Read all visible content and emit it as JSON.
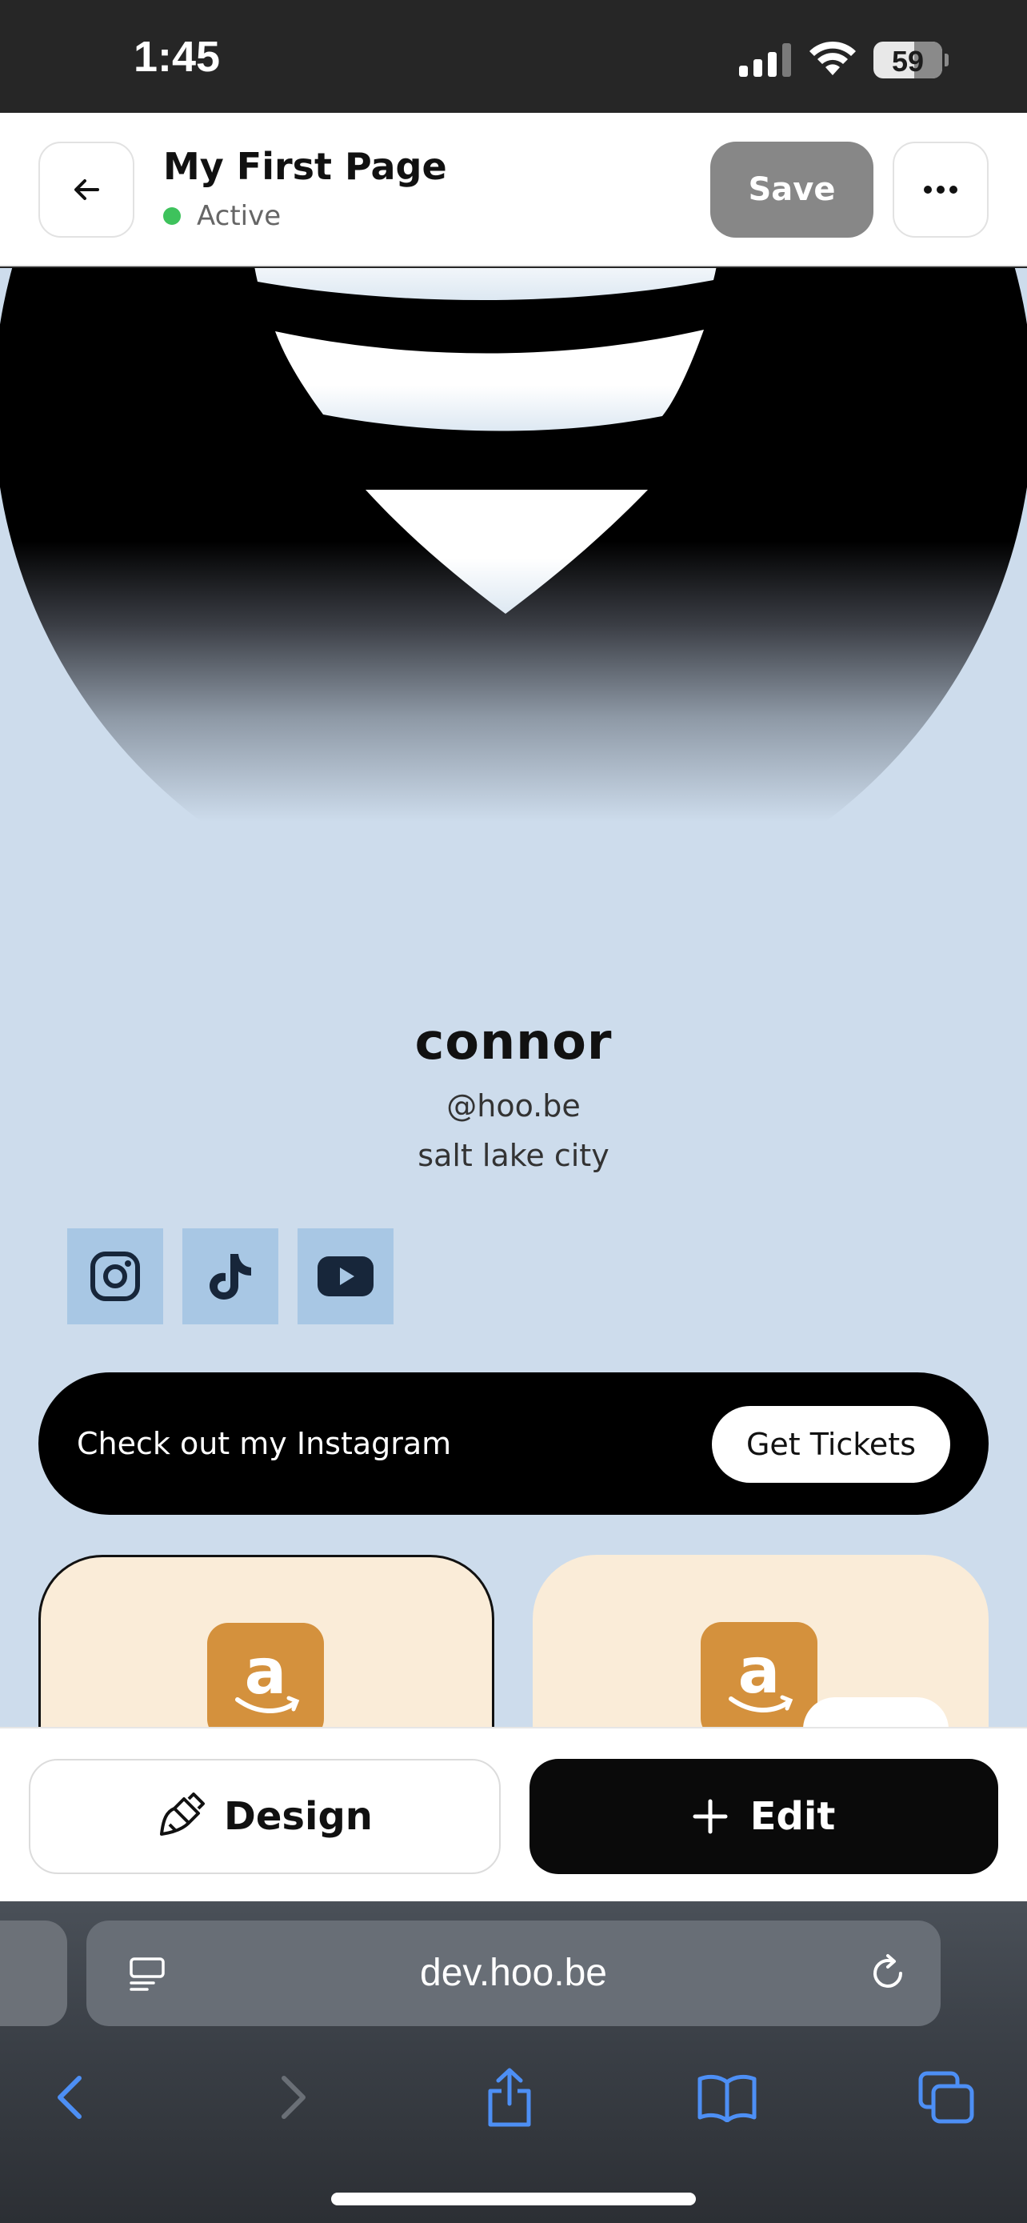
{
  "status_bar": {
    "time": "1:45",
    "battery": "59",
    "battery_level": 0.59
  },
  "header": {
    "title": "My First Page",
    "status": "Active",
    "save_label": "Save"
  },
  "profile": {
    "name": "connor",
    "handle": "@hoo.be",
    "location": "salt lake city"
  },
  "socials": [
    "instagram-icon",
    "tiktok-icon",
    "youtube-icon"
  ],
  "link": {
    "text": "Check out my Instagram",
    "button": "Get Tickets"
  },
  "actions": {
    "design_label": "Design",
    "edit_label": "Edit"
  },
  "browser": {
    "url": "dev.hoo.be"
  },
  "colors": {
    "preview_bg": "#cddcec",
    "social_tile": "#a8c7e4",
    "active": "#3ec25c",
    "amazon": "#d4913d",
    "card": "#faecd8"
  }
}
